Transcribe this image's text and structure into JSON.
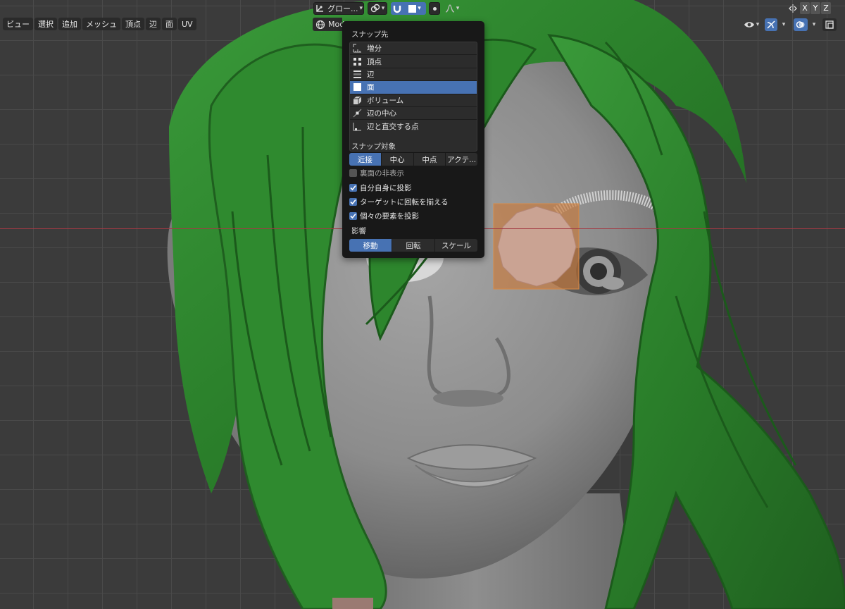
{
  "header": {
    "transform_orientation": "グロー...",
    "axes": [
      "X",
      "Y",
      "Z"
    ]
  },
  "menu": [
    "ビュー",
    "選択",
    "追加",
    "メッシュ",
    "頂点",
    "辺",
    "面",
    "UV"
  ],
  "mode": {
    "label": "Mod"
  },
  "snap_popover": {
    "snap_to_label": "スナップ先",
    "elements": [
      {
        "icon": "increment-icon",
        "label": "増分"
      },
      {
        "icon": "vertex-icon",
        "label": "頂点"
      },
      {
        "icon": "edge-icon",
        "label": "辺"
      },
      {
        "icon": "face-icon",
        "label": "面"
      },
      {
        "icon": "volume-icon",
        "label": "ボリューム"
      },
      {
        "icon": "edge-center-icon",
        "label": "辺の中心"
      },
      {
        "icon": "edge-perpendicular-icon",
        "label": "辺と直交する点"
      }
    ],
    "selected_element": "面",
    "snap_with_label": "スナップ対象",
    "snap_with": [
      "近接",
      "中心",
      "中点",
      "アクテ..."
    ],
    "snap_with_selected": "近接",
    "options": [
      {
        "label": "裏面の非表示",
        "checked": false
      },
      {
        "label": "自分自身に投影",
        "checked": true
      },
      {
        "label": "ターゲットに回転を揃える",
        "checked": true
      },
      {
        "label": "個々の要素を投影",
        "checked": true
      }
    ],
    "affect_label": "影響",
    "affect": [
      "移動",
      "回転",
      "スケール"
    ],
    "affect_selected": "移動"
  },
  "colors": {
    "accent": "#4772b3",
    "popover_bg": "#181818",
    "viewport_bg": "#3b3b3b",
    "hair": "#2f8a2f",
    "skin": "#8a8a8a",
    "selection": "#c97a3a"
  }
}
